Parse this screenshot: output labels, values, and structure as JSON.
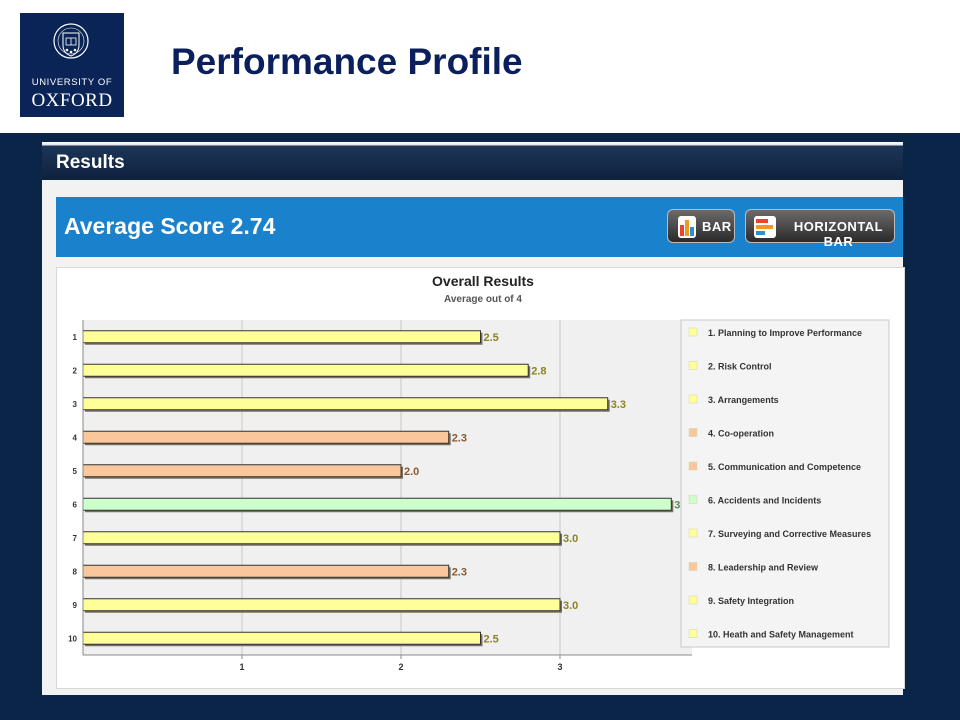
{
  "header": {
    "logo_line1": "UNIVERSITY OF",
    "logo_line2": "OXFORD",
    "page_title": "Performance Profile"
  },
  "app": {
    "section_title": "Results",
    "average_label": "Average Score 2.74",
    "buttons": {
      "bar": "BAR",
      "horizontal_bar": "HORIZONTAL BAR"
    }
  },
  "colors": {
    "yellow": "#ffff99",
    "orange": "#f9c79b",
    "green": "#ccffcc",
    "accent": "#1a82cc",
    "navy": "#0b2458"
  },
  "chart_data": {
    "type": "bar",
    "orientation": "horizontal",
    "title": "Overall Results",
    "subtitle": "Average out of 4",
    "categories": [
      "1",
      "2",
      "3",
      "4",
      "5",
      "6",
      "7",
      "8",
      "9",
      "10"
    ],
    "values": [
      2.5,
      2.8,
      3.3,
      2.3,
      2.0,
      3.7,
      3.0,
      2.3,
      3.0,
      2.5
    ],
    "value_labels": [
      "2.5",
      "2.8",
      "3.3",
      "2.3",
      "2.0",
      "3",
      "3.0",
      "2.3",
      "3.0",
      "2.5"
    ],
    "bar_colors": [
      "yellow",
      "yellow",
      "yellow",
      "orange",
      "orange",
      "green",
      "yellow",
      "orange",
      "yellow",
      "yellow"
    ],
    "xlim": [
      0,
      4
    ],
    "x_ticks": [
      1,
      2,
      3
    ],
    "legend": [
      {
        "label": "1. Planning to Improve Performance",
        "color": "yellow"
      },
      {
        "label": "2. Risk Control",
        "color": "yellow"
      },
      {
        "label": "3. Arrangements",
        "color": "yellow"
      },
      {
        "label": "4. Co-operation",
        "color": "orange"
      },
      {
        "label": "5. Communication and Competence",
        "color": "orange"
      },
      {
        "label": "6. Accidents and Incidents",
        "color": "green"
      },
      {
        "label": "7. Surveying and Corrective Measures",
        "color": "yellow"
      },
      {
        "label": "8. Leadership and Review",
        "color": "orange"
      },
      {
        "label": "9. Safety Integration",
        "color": "yellow"
      },
      {
        "label": "10. Heath and Safety Management",
        "color": "yellow"
      }
    ],
    "legend_position": "right",
    "grid": true
  }
}
